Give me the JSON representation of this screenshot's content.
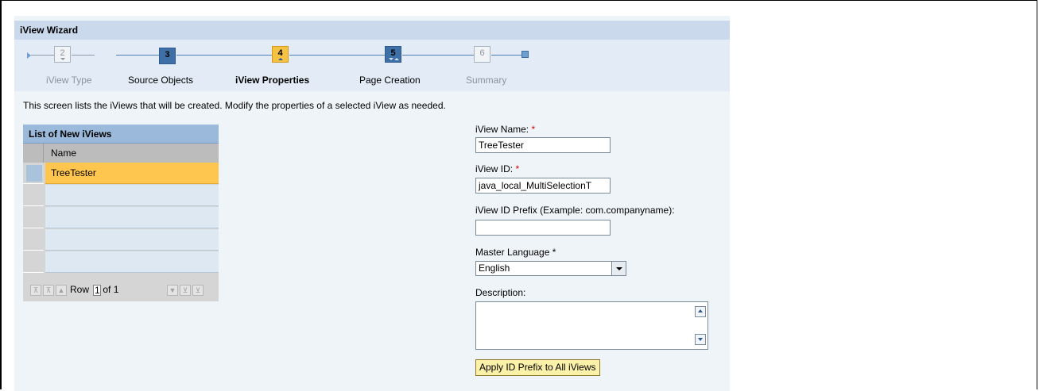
{
  "wizard": {
    "title": "iView Wizard",
    "steps": [
      {
        "number": "2",
        "label": "iView Type",
        "state": "disabled"
      },
      {
        "number": "3",
        "label": "Source Objects",
        "state": "done"
      },
      {
        "number": "4",
        "label": "iView Properties",
        "state": "current"
      },
      {
        "number": "5",
        "label": "Page Creation",
        "state": "next"
      },
      {
        "number": "6",
        "label": "Summary",
        "state": "disabled"
      }
    ],
    "intro": "This screen lists the iViews that will be created. Modify the properties of a selected iView as needed."
  },
  "list": {
    "title": "List of New iViews",
    "column": "Name",
    "rows": [
      "TreeTester",
      "",
      "",
      "",
      ""
    ],
    "pager": {
      "row_label": "Row",
      "current": "1",
      "of_label": "of 1"
    }
  },
  "form": {
    "iview_name_label": "iView Name:",
    "iview_name_value": "TreeTester",
    "iview_id_label": "iView ID:",
    "iview_id_value": "java_local_MultiSelectionT",
    "prefix_label": "iView ID Prefix (Example: com.companyname):",
    "prefix_value": "",
    "master_language_label": "Master Language *",
    "master_language_value": "English",
    "description_label": "Description:",
    "description_value": "",
    "apply_button": "Apply ID Prefix to All iViews",
    "required_marker": "*"
  },
  "colors": {
    "header_blue": "#cad9ec",
    "current_step": "#f6c244",
    "selected_row": "#ffc64f",
    "required": "#d00000"
  }
}
